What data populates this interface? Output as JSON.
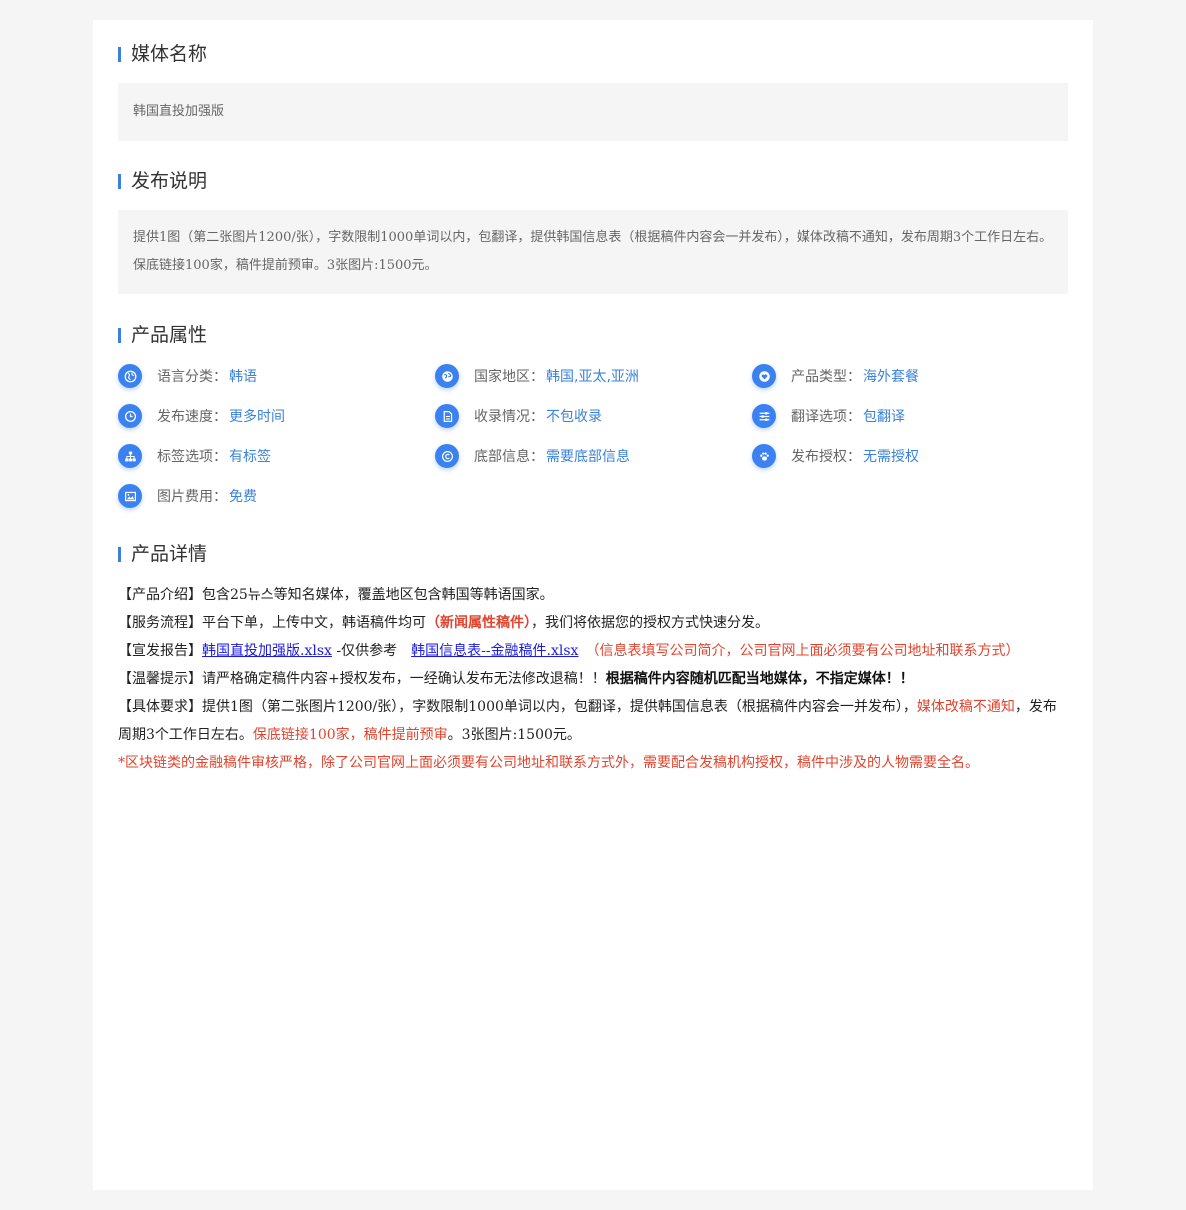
{
  "sections": {
    "media_name_title": "媒体名称",
    "publish_desc_title": "发布说明",
    "attrs_title": "产品属性",
    "details_title": "产品详情"
  },
  "media_name": "韩国直投加强版",
  "publish_desc": "提供1图（第二张图片1200/张），字数限制1000单词以内，包翻译，提供韩国信息表（根据稿件内容会一并发布），媒体改稿不通知，发布周期3个工作日左右。保底链接100家，稿件提前预审。3张图片:1500元。",
  "attributes": [
    {
      "label": "语言分类：",
      "value": "韩语",
      "icon": "globe-icon"
    },
    {
      "label": "国家地区：",
      "value": "韩国,亚太,亚洲",
      "icon": "earth-icon"
    },
    {
      "label": "产品类型：",
      "value": "海外套餐",
      "icon": "heart-icon"
    },
    {
      "label": "发布速度：",
      "value": "更多时间",
      "icon": "clock-icon"
    },
    {
      "label": "收录情况：",
      "value": "不包收录",
      "icon": "document-icon"
    },
    {
      "label": "翻译选项：",
      "value": "包翻译",
      "icon": "sliders-icon"
    },
    {
      "label": "标签选项：",
      "value": "有标签",
      "icon": "sitemap-icon"
    },
    {
      "label": "底部信息：",
      "value": "需要底部信息",
      "icon": "copyright-icon"
    },
    {
      "label": "发布授权：",
      "value": "无需授权",
      "icon": "paw-icon"
    },
    {
      "label": "图片费用：",
      "value": "免费",
      "icon": "image-icon"
    }
  ],
  "details": {
    "intro_label": "【产品介绍】",
    "intro_text": "包含25뉴스等知名媒体，覆盖地区包含韩国等韩语国家。",
    "process_label": "【服务流程】",
    "process_text_1": "平台下单，上传中文，韩语稿件均可",
    "process_highlight": "（新闻属性稿件）",
    "process_text_2": "，我们将依据您的授权方式快速分发。",
    "report_label": "【宣发报告】",
    "report_link_1": "韩国直投加强版.xlsx",
    "report_text": " -仅供参考　",
    "report_link_2": "韩国信息表--金融稿件.xlsx",
    "report_note": "　（信息表填写公司简介，公司官网上面必须要有公司地址和联系方式）",
    "tip_label": "【温馨提示】",
    "tip_text": "请严格确定稿件内容+授权发布，一经确认发布无法修改退稿！！",
    "tip_bold": "根据稿件内容随机匹配当地媒体，不指定媒体！！",
    "req_label": "【具体要求】",
    "req_text_1": "提供1图（第二张图片1200/张），字数限制1000单词以内，包翻译，提供韩国信息表（根据稿件内容会一并发布），",
    "req_red_1": "媒体改稿不通知",
    "req_text_2": "，发布周期3个工作日左右。",
    "req_red_2": "保底链接100家，稿件提前预审",
    "req_text_3": "。3张图片:1500元。",
    "warning": "*区块链类的金融稿件审核严格，除了公司官网上面必须要有公司地址和联系方式外，需要配合发稿机构授权，稿件中涉及的人物需要全名。"
  },
  "colors": {
    "accent": "#3b7fe0",
    "value": "#3b82d8",
    "red": "#e0452f",
    "link": "#1a1ae0"
  }
}
